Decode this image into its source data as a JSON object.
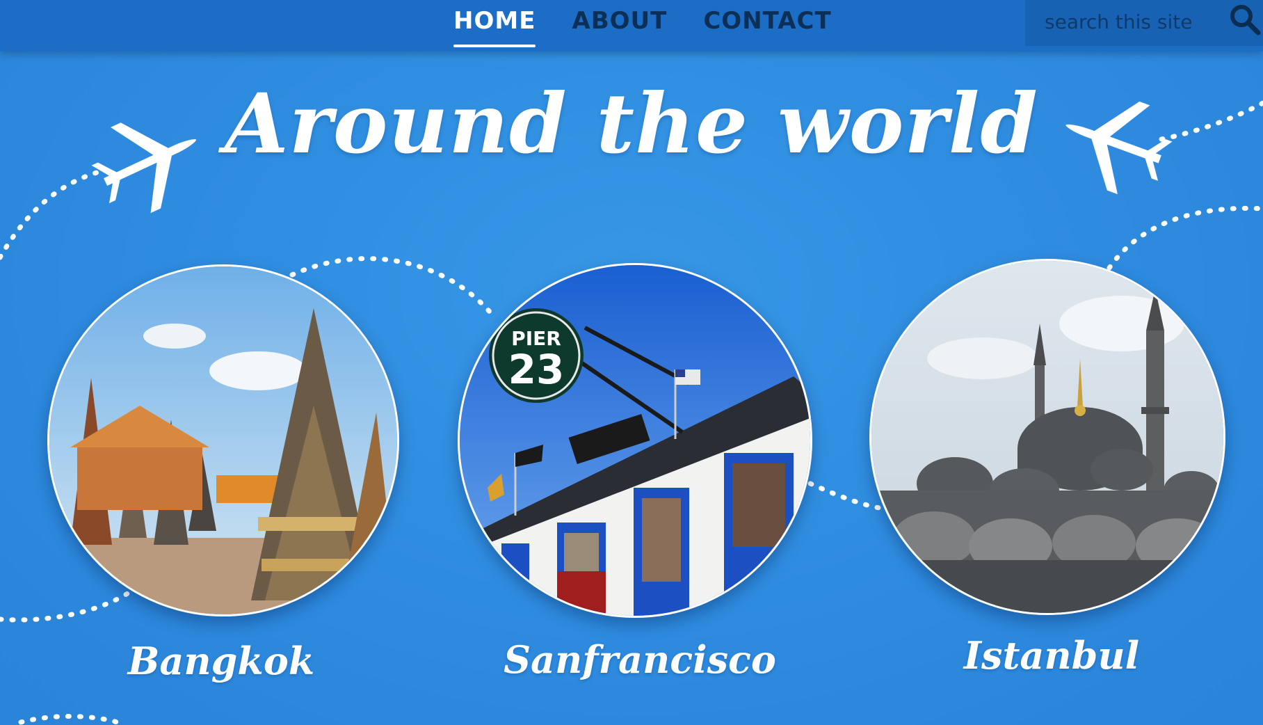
{
  "nav": {
    "items": [
      {
        "label": "HOME",
        "active": true
      },
      {
        "label": "ABOUT",
        "active": false
      },
      {
        "label": "CONTACT",
        "active": false
      }
    ]
  },
  "search": {
    "placeholder": "search this site",
    "icon": "search-icon"
  },
  "hero": {
    "title": "Around the world"
  },
  "cities": [
    {
      "name": "Bangkok",
      "icon": "temple-photo"
    },
    {
      "name": "Sanfrancisco",
      "icon": "pier-photo"
    },
    {
      "name": "Istanbul",
      "icon": "mosque-photo"
    }
  ],
  "colors": {
    "background": "#2e8fe0",
    "navbar": "#1c6dc6",
    "nav_text": "#0c2f56",
    "active_text": "#ffffff"
  }
}
